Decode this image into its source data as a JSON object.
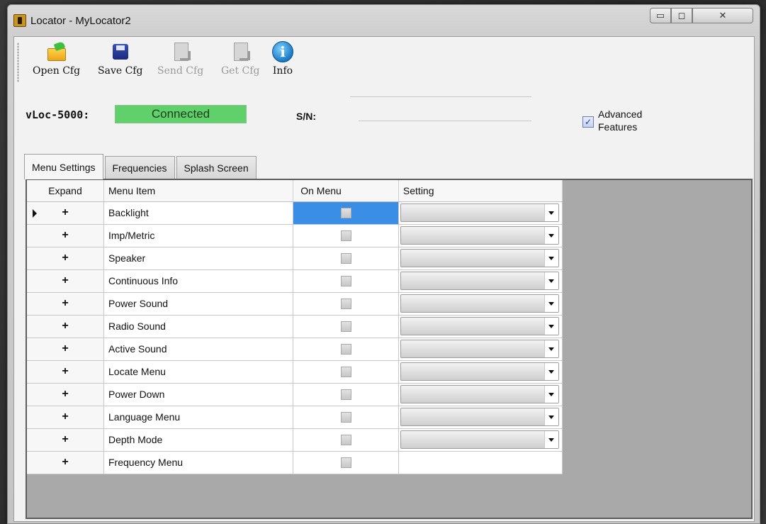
{
  "window": {
    "title": "Locator - MyLocator2",
    "controls": {
      "minimize": "▭",
      "maximize": "◻",
      "close": "✕"
    }
  },
  "toolbar": {
    "open_label": "Open Cfg",
    "save_label": "Save Cfg",
    "send_label": "Send Cfg",
    "get_label": "Get Cfg",
    "info_label": "Info",
    "info_glyph": "i"
  },
  "device": {
    "label": "vLoc-5000:",
    "status": "Connected",
    "status_color": "#5fd06a",
    "sn_label": "S/N:"
  },
  "advanced": {
    "checked": true,
    "check_glyph": "✓",
    "label_line1": "Advanced",
    "label_line2": "Features"
  },
  "tabs": [
    {
      "label": "Menu Settings",
      "active": true
    },
    {
      "label": "Frequencies",
      "active": false
    },
    {
      "label": "Splash Screen",
      "active": false
    }
  ],
  "grid": {
    "headers": {
      "expand": "Expand",
      "menu_item": "Menu Item",
      "on_menu": "On Menu",
      "setting": "Setting"
    },
    "expand_glyph": "+",
    "rows": [
      {
        "item": "Backlight",
        "has_setting": true,
        "current": true
      },
      {
        "item": "Imp/Metric",
        "has_setting": true
      },
      {
        "item": "Speaker",
        "has_setting": true
      },
      {
        "item": "Continuous Info",
        "has_setting": true
      },
      {
        "item": "Power Sound",
        "has_setting": true
      },
      {
        "item": "Radio Sound",
        "has_setting": true
      },
      {
        "item": "Active Sound",
        "has_setting": true
      },
      {
        "item": "Locate Menu",
        "has_setting": true
      },
      {
        "item": "Power Down",
        "has_setting": true
      },
      {
        "item": "Language Menu",
        "has_setting": true
      },
      {
        "item": "Depth Mode",
        "has_setting": true
      },
      {
        "item": "Frequency Menu",
        "has_setting": false
      }
    ]
  },
  "colors": {
    "selection": "#3a8ee6",
    "panel_bg": "#a9a9a9"
  }
}
